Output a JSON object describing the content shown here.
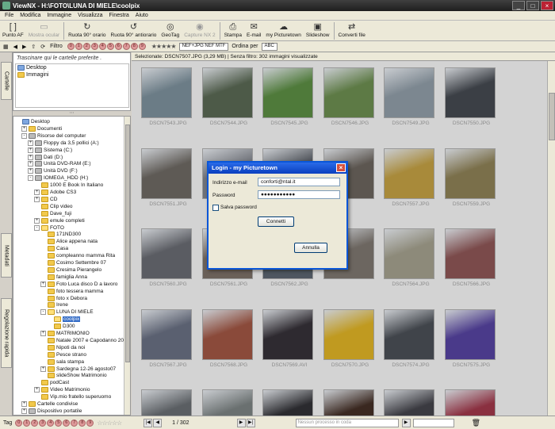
{
  "window": {
    "title": "ViewNX - H:\\FOTO\\LUNA DI MIELE\\coolpix"
  },
  "menu": [
    "File",
    "Modifica",
    "Immagine",
    "Visualizza",
    "Finestra",
    "Aiuto"
  ],
  "toolbar": [
    {
      "label": "Punto AF",
      "icon": "af-point-icon",
      "glyph": "[ ]",
      "enabled": true
    },
    {
      "label": "Mostra ocular",
      "icon": "display-icon",
      "glyph": "▭",
      "enabled": false
    },
    {
      "label": "Ruota 90° orario",
      "icon": "rotate-cw-icon",
      "glyph": "↻",
      "enabled": true
    },
    {
      "label": "Ruota 90° antiorario",
      "icon": "rotate-ccw-icon",
      "glyph": "↺",
      "enabled": true
    },
    {
      "label": "GeoTag",
      "icon": "geotag-icon",
      "glyph": "◎",
      "enabled": true
    },
    {
      "label": "Capture NX 2",
      "icon": "capture-nx-icon",
      "glyph": "◉",
      "enabled": false
    },
    {
      "label": "Stampa",
      "icon": "print-icon",
      "glyph": "⎙",
      "enabled": true
    },
    {
      "label": "E-mail",
      "icon": "email-icon",
      "glyph": "✉",
      "enabled": true
    },
    {
      "label": "my Picturetown",
      "icon": "picturetown-icon",
      "glyph": "☁",
      "enabled": true
    },
    {
      "label": "Slideshow",
      "icon": "slideshow-icon",
      "glyph": "▣",
      "enabled": true
    },
    {
      "label": "Converti file",
      "icon": "convert-icon",
      "glyph": "⇄",
      "enabled": true
    }
  ],
  "toolbar2": {
    "filter_label": "Filtro",
    "labels": [
      "0",
      "1",
      "2",
      "3",
      "4",
      "5",
      "6",
      "7",
      "8",
      "9"
    ],
    "stars": "★★★★★",
    "filter_box": "NEF+JPG NEF MTF",
    "sort_label": "Ordina per",
    "sort_icon": "ABC"
  },
  "left_tabs": [
    "Cartelle",
    "Metadati",
    "Regolazione rapida"
  ],
  "favorites": {
    "hint": "Trascinare qui le cartelle preferite .",
    "items": [
      "Desktop",
      "Immagini"
    ]
  },
  "tree": [
    {
      "label": "Desktop",
      "depth": 0,
      "exp": "",
      "kind": "blue"
    },
    {
      "label": "Documenti",
      "depth": 1,
      "exp": "+",
      "kind": "folder"
    },
    {
      "label": "Risorse del computer",
      "depth": 1,
      "exp": "-",
      "kind": "drive"
    },
    {
      "label": "Floppy da 3,5 pollici (A:)",
      "depth": 2,
      "exp": "+",
      "kind": "drive"
    },
    {
      "label": "Sistema (C:)",
      "depth": 2,
      "exp": "+",
      "kind": "drive"
    },
    {
      "label": "Dati (D:)",
      "depth": 2,
      "exp": "+",
      "kind": "drive"
    },
    {
      "label": "Unità DVD-RAM (E:)",
      "depth": 2,
      "exp": "+",
      "kind": "drive"
    },
    {
      "label": "Unità DVD (F:)",
      "depth": 2,
      "exp": "+",
      "kind": "drive"
    },
    {
      "label": "IOMEGA_HDD (H:)",
      "depth": 2,
      "exp": "-",
      "kind": "drive"
    },
    {
      "label": "1000 E Book In Italiano",
      "depth": 3,
      "exp": "",
      "kind": "folder"
    },
    {
      "label": "Adobe CS3",
      "depth": 3,
      "exp": "+",
      "kind": "folder"
    },
    {
      "label": "CD",
      "depth": 3,
      "exp": "+",
      "kind": "folder"
    },
    {
      "label": "Clip video",
      "depth": 3,
      "exp": "",
      "kind": "folder"
    },
    {
      "label": "Dave_fuji",
      "depth": 3,
      "exp": "",
      "kind": "folder"
    },
    {
      "label": "emule completi",
      "depth": 3,
      "exp": "+",
      "kind": "folder"
    },
    {
      "label": "FOTO",
      "depth": 3,
      "exp": "-",
      "kind": "open"
    },
    {
      "label": "171ND300",
      "depth": 4,
      "exp": "",
      "kind": "folder"
    },
    {
      "label": "Alice appena nata",
      "depth": 4,
      "exp": "",
      "kind": "folder"
    },
    {
      "label": "Casa",
      "depth": 4,
      "exp": "",
      "kind": "folder"
    },
    {
      "label": "compleanno mamma Rita",
      "depth": 4,
      "exp": "",
      "kind": "folder"
    },
    {
      "label": "Cosimo Settembre 07",
      "depth": 4,
      "exp": "",
      "kind": "folder"
    },
    {
      "label": "Cresima Pierangelo",
      "depth": 4,
      "exp": "",
      "kind": "folder"
    },
    {
      "label": "famiglia Anna",
      "depth": 4,
      "exp": "",
      "kind": "folder"
    },
    {
      "label": "Foto Luca disco D a lavoro",
      "depth": 4,
      "exp": "+",
      "kind": "folder"
    },
    {
      "label": "foto tessera mamma",
      "depth": 4,
      "exp": "",
      "kind": "folder"
    },
    {
      "label": "foto x Debora",
      "depth": 4,
      "exp": "",
      "kind": "folder"
    },
    {
      "label": "Irene",
      "depth": 4,
      "exp": "",
      "kind": "folder"
    },
    {
      "label": "LUNA DI MIELE",
      "depth": 4,
      "exp": "-",
      "kind": "open"
    },
    {
      "label": "coolpix",
      "depth": 5,
      "exp": "",
      "kind": "open",
      "selected": true
    },
    {
      "label": "D300",
      "depth": 5,
      "exp": "",
      "kind": "folder"
    },
    {
      "label": "MATRIMONIO",
      "depth": 4,
      "exp": "+",
      "kind": "folder"
    },
    {
      "label": "Natale 2007 e Capodanno 20",
      "depth": 4,
      "exp": "",
      "kind": "folder"
    },
    {
      "label": "Nipoti da noi",
      "depth": 4,
      "exp": "",
      "kind": "folder"
    },
    {
      "label": "Pesce strano",
      "depth": 4,
      "exp": "",
      "kind": "folder"
    },
    {
      "label": "sala stampa",
      "depth": 4,
      "exp": "",
      "kind": "folder"
    },
    {
      "label": "Sardegna 12-26 agosto07",
      "depth": 4,
      "exp": "+",
      "kind": "folder"
    },
    {
      "label": "slideShow Matrimonio",
      "depth": 4,
      "exp": "",
      "kind": "folder"
    },
    {
      "label": "podCast",
      "depth": 3,
      "exp": "",
      "kind": "folder"
    },
    {
      "label": "Video Matrimonio",
      "depth": 3,
      "exp": "+",
      "kind": "folder"
    },
    {
      "label": "Vip.mio fratello superuomo",
      "depth": 3,
      "exp": "",
      "kind": "folder"
    },
    {
      "label": "Cartelle condivise",
      "depth": 1,
      "exp": "+",
      "kind": "folder"
    },
    {
      "label": "Dispositivo portatile",
      "depth": 1,
      "exp": "+",
      "kind": "drive"
    }
  ],
  "status_top": "Selezionate: DSCN7507.JPG (3,29 MB) | Senza filtro: 302 immagini visualizzate",
  "thumbnails": [
    {
      "name": "DSCN7543.JPG",
      "color": "#6b7c86"
    },
    {
      "name": "DSCN7544.JPG",
      "color": "#4d5a48"
    },
    {
      "name": "DSCN7545.JPG",
      "color": "#4f7a3a"
    },
    {
      "name": "DSCN7546.JPG",
      "color": "#5d7a45"
    },
    {
      "name": "DSCN7549.JPG",
      "color": "#7c8790"
    },
    {
      "name": "DSCN7550.JPG",
      "color": "#3b3f45"
    },
    {
      "name": "DSCN7551.JPG",
      "color": "#5e5a55"
    },
    {
      "name": "",
      "color": "#6d7077"
    },
    {
      "name": "",
      "color": "#4a4e55"
    },
    {
      "name": "",
      "color": "#5c5650"
    },
    {
      "name": "DSCN7557.JPG",
      "color": "#a88a3a"
    },
    {
      "name": "DSCN7559.JPG",
      "color": "#7a6f4a"
    },
    {
      "name": "DSCN7560.JPG",
      "color": "#5a5c62"
    },
    {
      "name": "DSCN7561.JPG",
      "color": "#6a6058"
    },
    {
      "name": "DSCN7562.JPG",
      "color": "#4e5660"
    },
    {
      "name": "",
      "color": "#6c6660"
    },
    {
      "name": "DSCN7564.JPG",
      "color": "#8d8a7a"
    },
    {
      "name": "DSCN7566.JPG",
      "color": "#7a4a4a"
    },
    {
      "name": "DSCN7567.JPG",
      "color": "#5a6070"
    },
    {
      "name": "DSCN7568.JPG",
      "color": "#8a4a3a"
    },
    {
      "name": "DSCN7569.AVI",
      "color": "#2e2a30"
    },
    {
      "name": "DSCN7570.JPG",
      "color": "#c09a20"
    },
    {
      "name": "DSCN7574.JPG",
      "color": "#40444a"
    },
    {
      "name": "DSCN7575.JPG",
      "color": "#4a3a8a"
    },
    {
      "name": "",
      "color": "#5a5e62"
    },
    {
      "name": "",
      "color": "#6a7070"
    },
    {
      "name": "",
      "color": "#2a2a2e"
    },
    {
      "name": "",
      "color": "#3a2820"
    },
    {
      "name": "",
      "color": "#3a3a40"
    },
    {
      "name": "",
      "color": "#8a3040"
    }
  ],
  "dialog": {
    "title": "Login - my Picturetown",
    "email_label": "Indirizzo e-mail",
    "email_value": "conforti@ntal.it",
    "password_label": "Password",
    "password_value": "●●●●●●●●●●●",
    "save_label": "Salva password",
    "connect_label": "Connetti",
    "cancel_label": "Annulla"
  },
  "bottom": {
    "tag_label": "Tag",
    "page": "1 / 302",
    "process_placeholder": "Nessun processo in coda"
  },
  "colors": {
    "dialog_title": "#0a3fbf",
    "selection": "#316ac5"
  }
}
